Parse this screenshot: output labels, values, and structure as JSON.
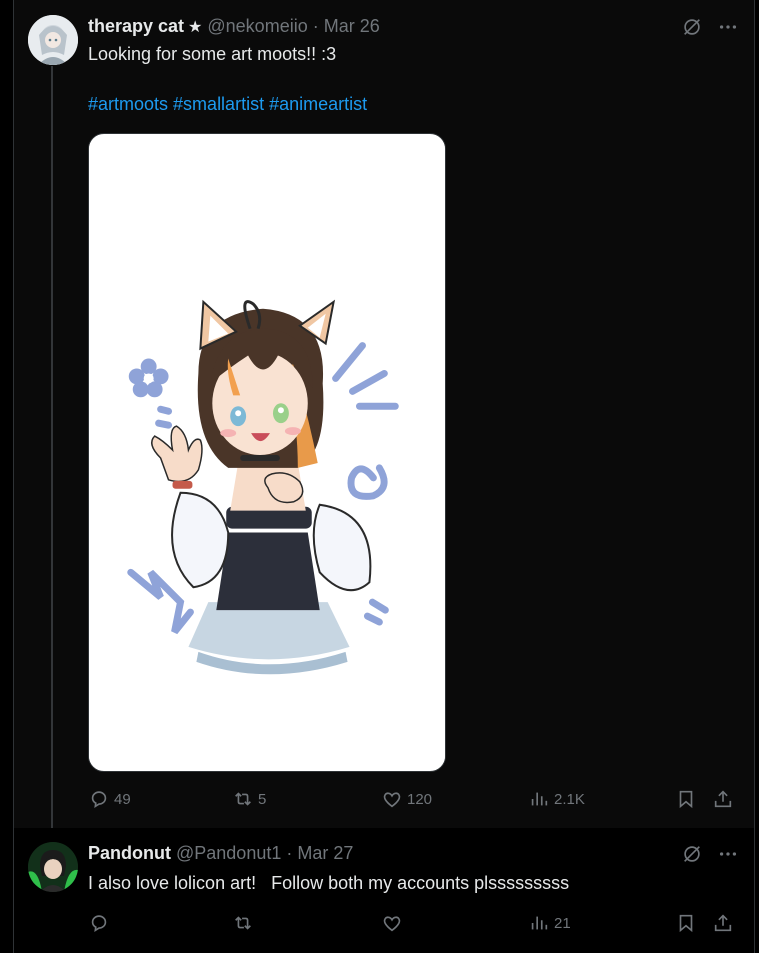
{
  "posts": [
    {
      "display_name": "therapy cat",
      "badge": "★",
      "handle": "@nekomeiio",
      "separator": "·",
      "date": "Mar 26",
      "text": "Looking for some art moots!! :3",
      "hashtags": [
        "#artmoots",
        "#smallartist",
        "#animeartist"
      ],
      "media": {
        "icon": "anime-catgirl-illustration"
      },
      "stats": {
        "replies": "49",
        "reposts": "5",
        "likes": "120",
        "views": "2.1K"
      }
    },
    {
      "display_name": "Pandonut",
      "handle": "@Pandonut1",
      "separator": "·",
      "date": "Mar 27",
      "text": "I also love lolicon art!   Follow both my accounts plsssssssss",
      "stats": {
        "replies": "",
        "reposts": "",
        "likes": "",
        "views": "21"
      }
    }
  ],
  "colors": {
    "background": "#000000",
    "text": "#e7e9ea",
    "muted": "#71767b",
    "link": "#1d9bf0",
    "border": "#2f3336"
  },
  "icons": {
    "grok": "grok-icon",
    "more": "more-icon",
    "reply": "reply-icon",
    "repost": "repost-icon",
    "like": "heart-icon",
    "views": "views-icon",
    "bookmark": "bookmark-icon",
    "share": "share-icon"
  }
}
